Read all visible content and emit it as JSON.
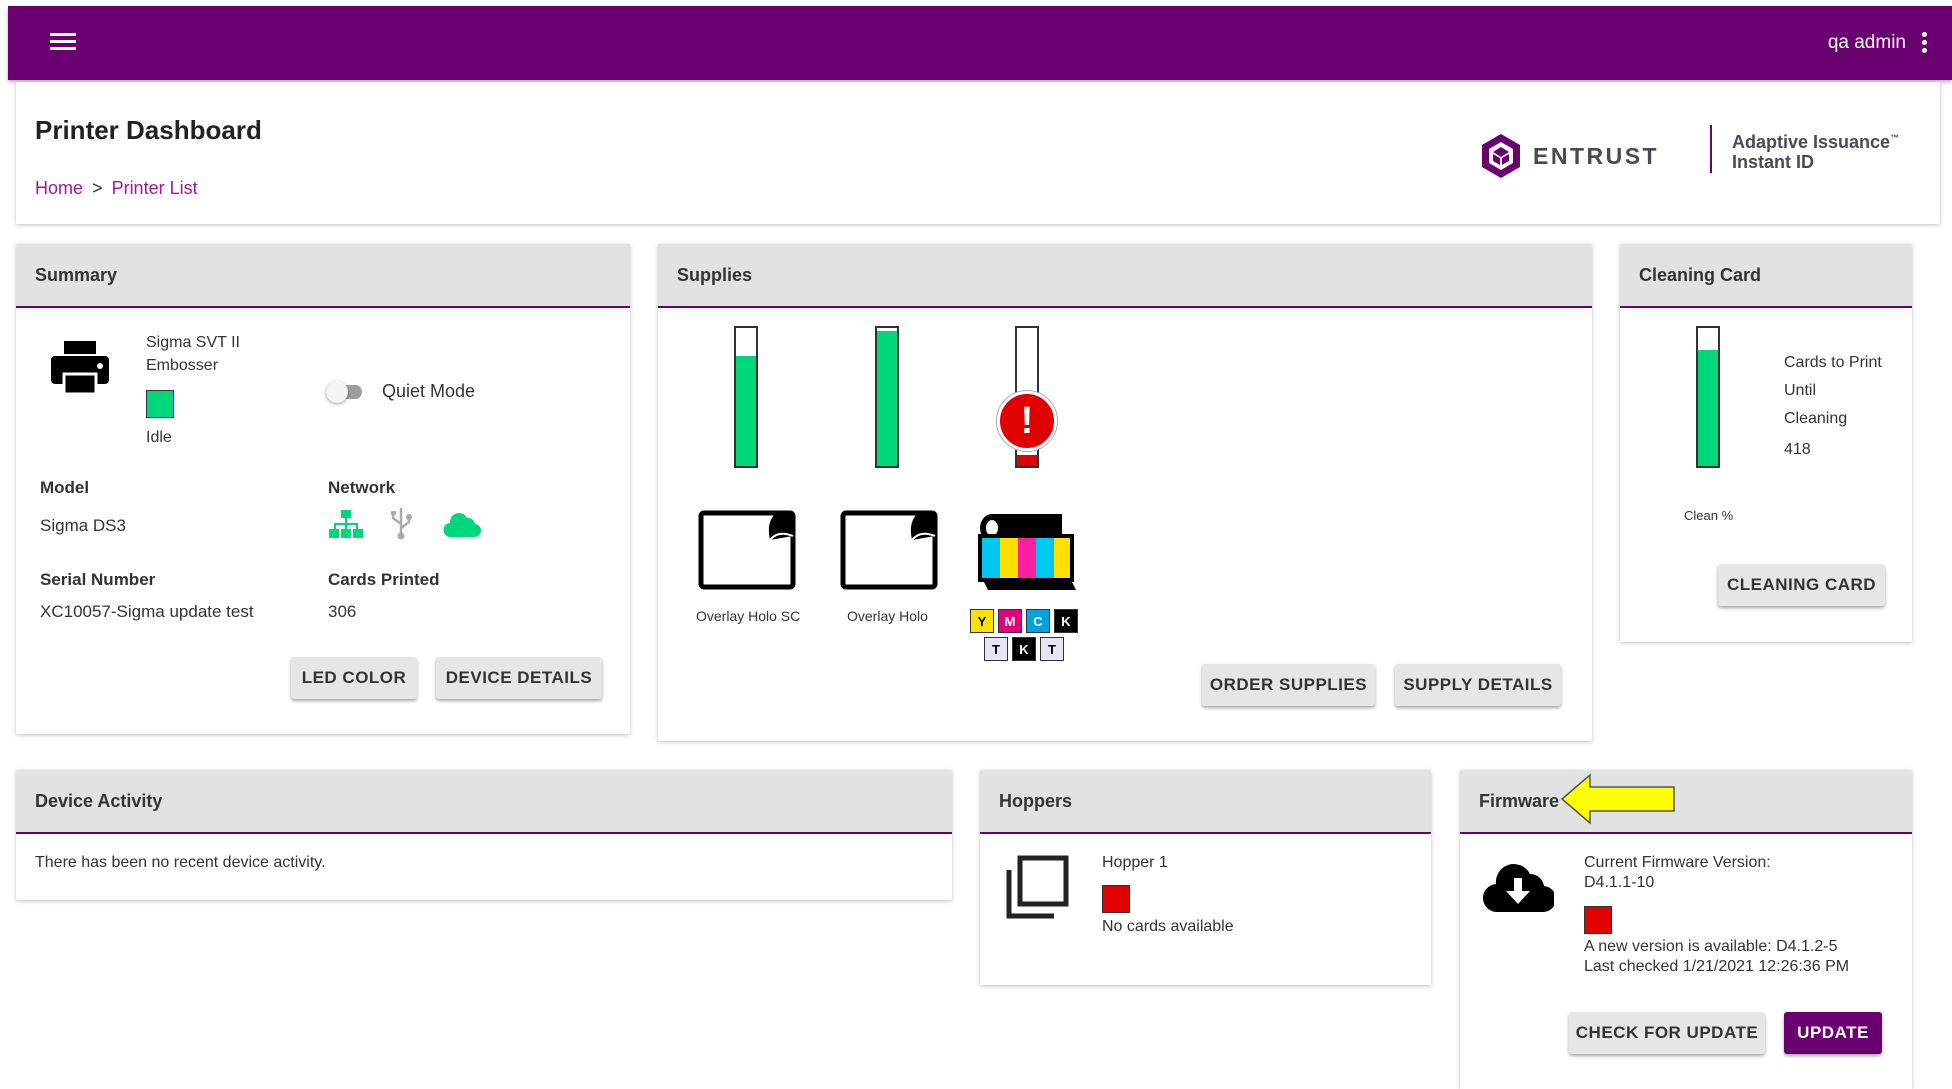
{
  "header": {
    "menu_icon": "hamburger-menu-icon",
    "user": "qa admin",
    "more_icon": "more-vert-icon",
    "color": "#6a006f"
  },
  "page": {
    "title": "Printer Dashboard",
    "breadcrumb": {
      "home": "Home",
      "sep": ">",
      "current": "Printer List"
    }
  },
  "logo": {
    "brand": "ENTRUST",
    "product_line1": "Adaptive Issuance",
    "tm": "™",
    "product_line2": "Instant ID"
  },
  "summary": {
    "title": "Summary",
    "printer_name_line1": "Sigma SVT II",
    "printer_name_line2": "Embosser",
    "status": "Idle",
    "status_color": "#00d77a",
    "quiet_mode_label": "Quiet Mode",
    "quiet_mode_on": false,
    "model_label": "Model",
    "model_value": "Sigma DS3",
    "network_label": "Network",
    "network_icons": [
      "ethernet-icon",
      "usb-icon",
      "cloud-icon"
    ],
    "serial_label": "Serial Number",
    "serial_value": "XC10057-Sigma update test",
    "cards_printed_label": "Cards Printed",
    "cards_printed_value": "306",
    "led_button": "LED COLOR",
    "details_button": "DEVICE DETAILS"
  },
  "supplies": {
    "title": "Supplies",
    "items": [
      {
        "name": "Overlay Holo SC",
        "level": 0.8,
        "color": "#00d77a"
      },
      {
        "name": "Overlay Holo",
        "level": 0.98,
        "color": "#00d77a"
      },
      {
        "name": "",
        "level": 0.08,
        "color": "#e00000",
        "alert": "!"
      }
    ],
    "ribbon_panels_top": [
      "Y",
      "M",
      "C",
      "K"
    ],
    "ribbon_panels_bottom": [
      "T",
      "K",
      "T"
    ],
    "order_button": "ORDER SUPPLIES",
    "details_button": "SUPPLY DETAILS"
  },
  "cleaning": {
    "title": "Cleaning Card",
    "level": 0.84,
    "gauge_label": "Clean %",
    "text_line1": "Cards to Print",
    "text_line2": "Until",
    "text_line3": "Cleaning",
    "count": "418",
    "button": "CLEANING CARD"
  },
  "activity": {
    "title": "Device Activity",
    "message": "There has been no recent device activity."
  },
  "hoppers": {
    "title": "Hoppers",
    "name": "Hopper 1",
    "status_color": "#e00000",
    "status": "No cards available"
  },
  "firmware": {
    "title": "Firmware",
    "current_label": "Current Firmware Version:",
    "current_value": "D4.1.1-10",
    "status_color": "#e00000",
    "available": "A new version is available: D4.1.2-5",
    "last_checked": "Last checked 1/21/2021 12:26:36 PM",
    "check_button": "CHECK FOR UPDATE",
    "update_button": "UPDATE"
  }
}
